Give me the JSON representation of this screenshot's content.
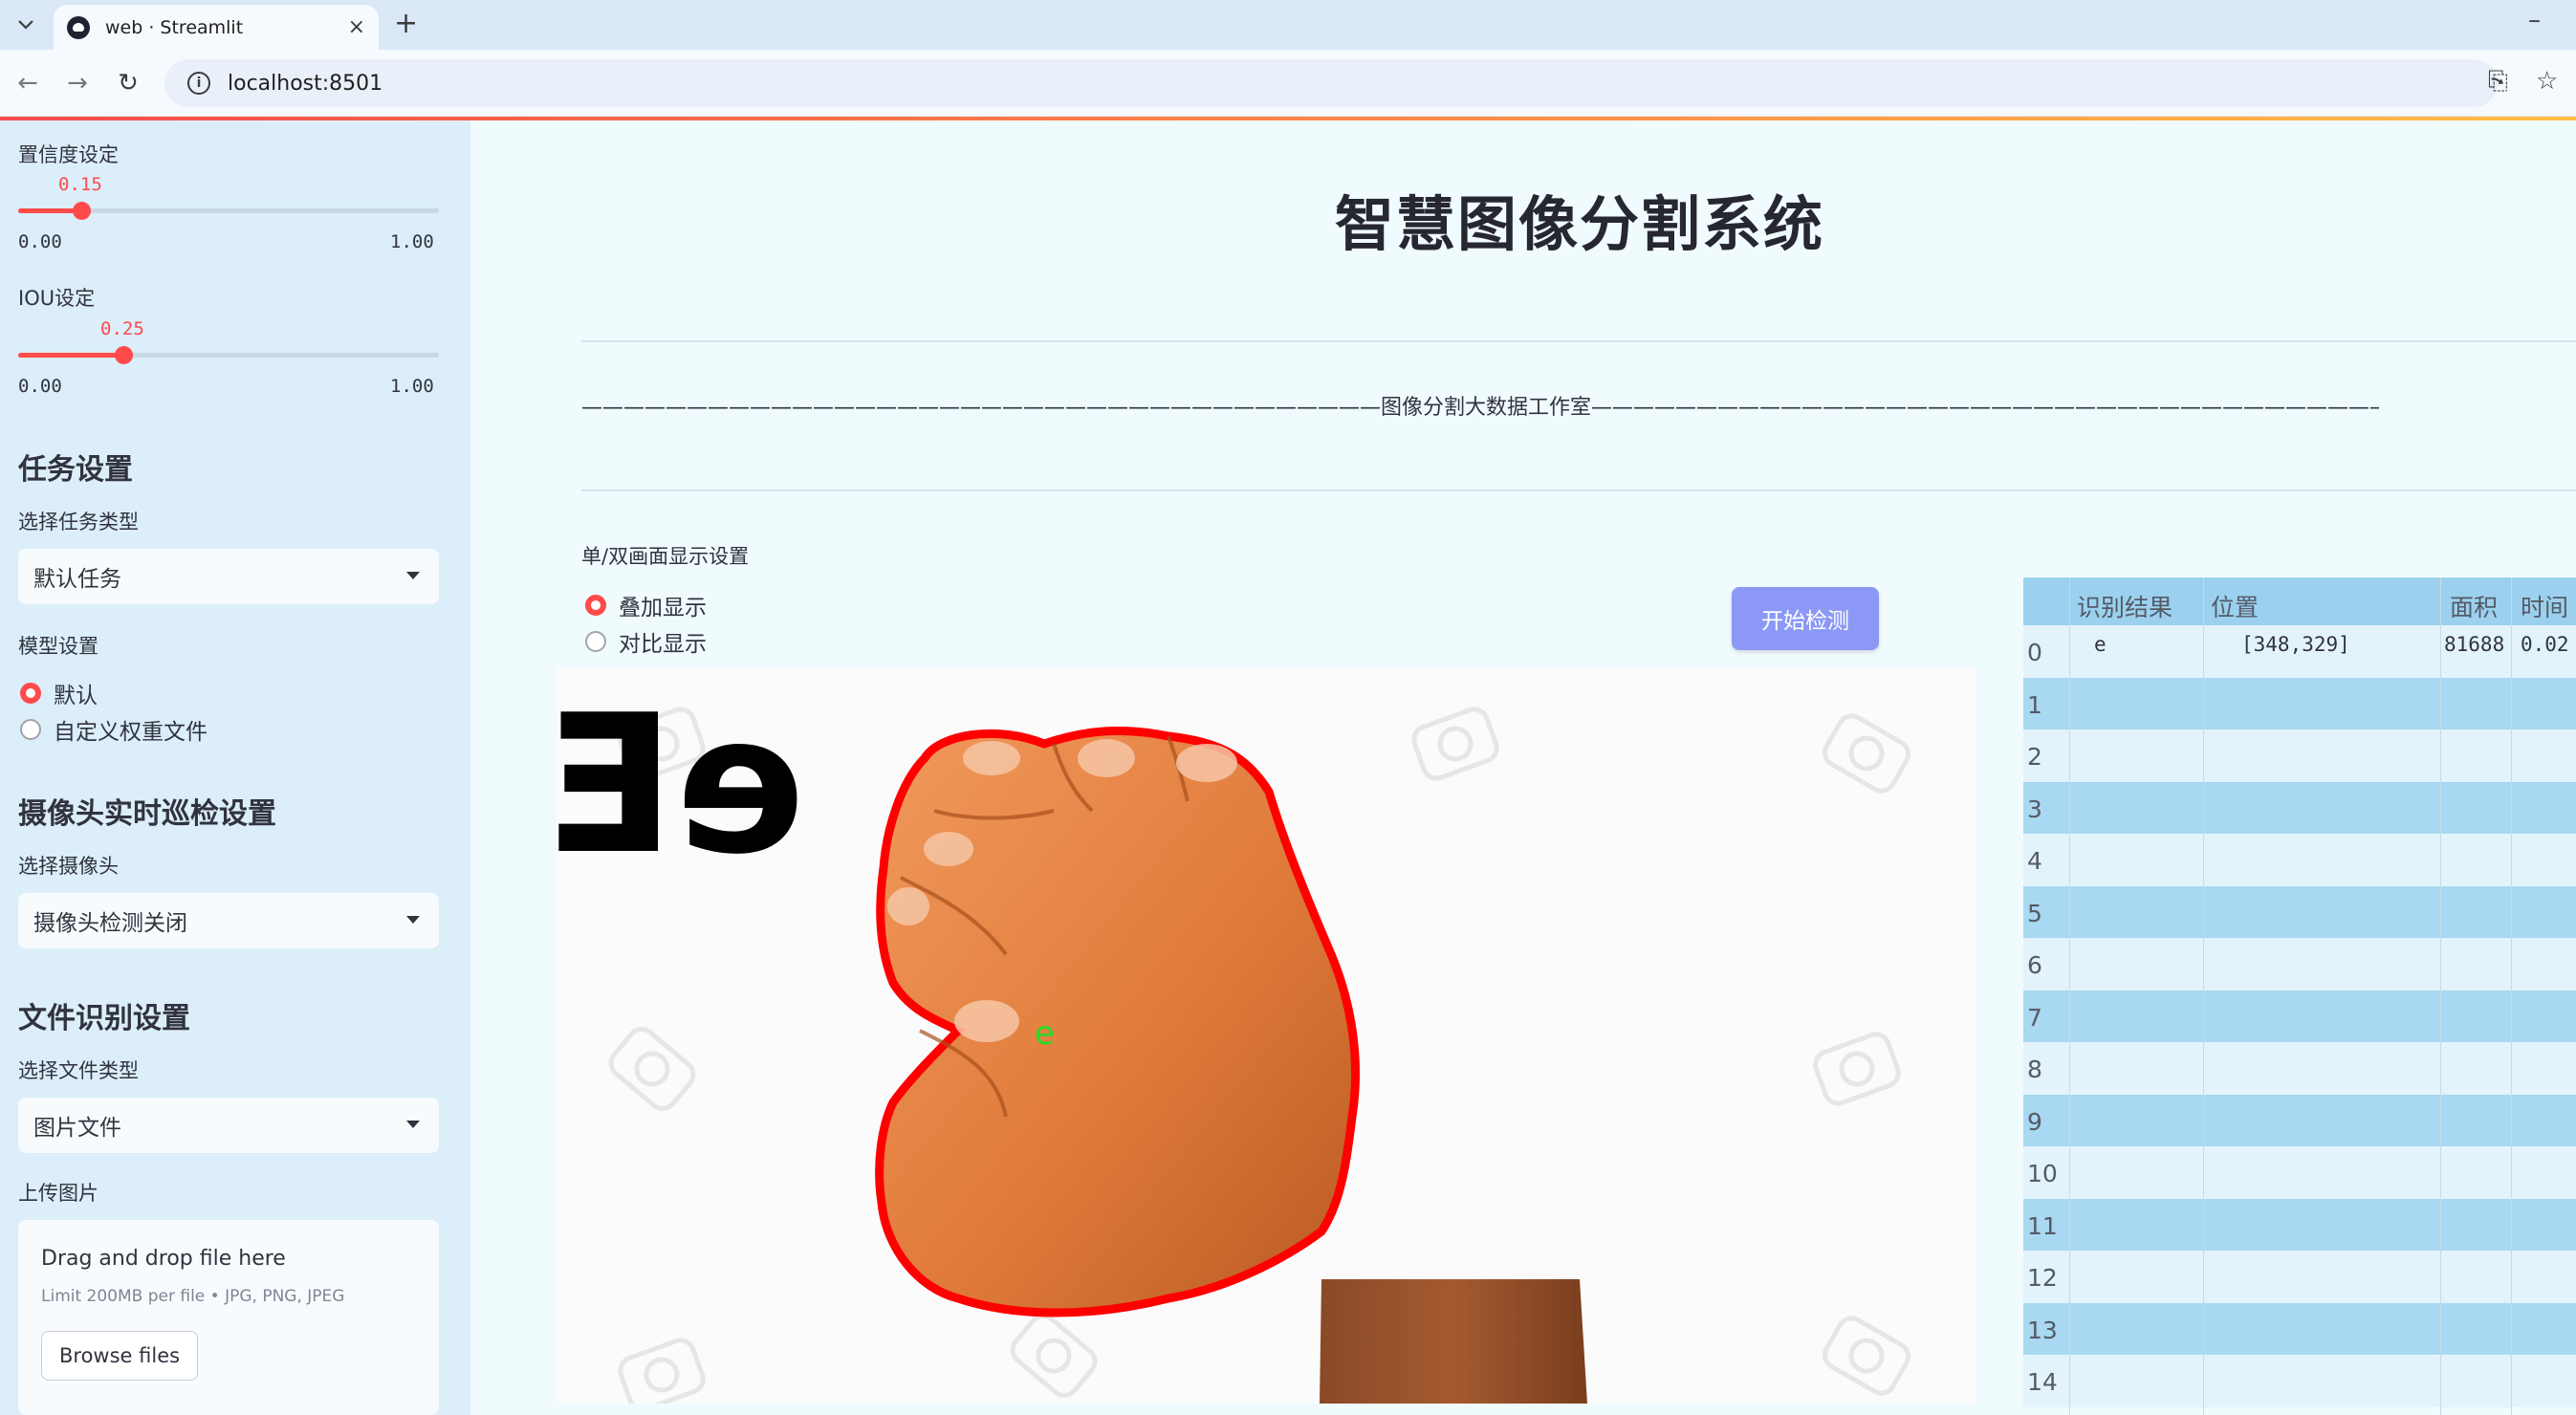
{
  "browser": {
    "tab_title": "web · Streamlit",
    "tab_close": "×",
    "new_tab": "+",
    "minimize": "–",
    "url": "localhost:8501",
    "back": "←",
    "forward": "→",
    "reload": "↻",
    "info": "i",
    "translate": "⎘",
    "star": "☆"
  },
  "sidebar": {
    "confidence": {
      "label": "置信度设定",
      "value_text": "0.15",
      "value": 0.15,
      "min": "0.00",
      "max": "1.00"
    },
    "iou": {
      "label": "IOU设定",
      "value_text": "0.25",
      "value": 0.25,
      "min": "0.00",
      "max": "1.00"
    },
    "task": {
      "header": "任务设置",
      "label": "选择任务类型",
      "selected": "默认任务"
    },
    "model": {
      "label": "模型设置",
      "options": [
        "默认",
        "自定义权重文件"
      ],
      "selected_index": 0
    },
    "camera": {
      "header": "摄像头实时巡检设置",
      "label": "选择摄像头",
      "selected": "摄像头检测关闭"
    },
    "file": {
      "header": "文件识别设置",
      "label": "选择文件类型",
      "selected": "图片文件"
    },
    "upload": {
      "label": "上传图片",
      "drop_text": "Drag and drop file here",
      "limit_text": "Limit 200MB per file • JPG, PNG, JPEG",
      "button": "Browse files"
    }
  },
  "main": {
    "title": "智慧图像分割系统",
    "divider_text": "——————————————————————————————————————图像分割大数据工作室——————————————————————————————————————————————",
    "display_label": "单/双画面显示设置",
    "display_options": [
      "叠加显示",
      "对比显示"
    ],
    "display_selected_index": 0,
    "detect_button": "开始检测",
    "image": {
      "overlay_text": "eE",
      "detection_label": "e",
      "watermark": "123RF"
    }
  },
  "table": {
    "columns": [
      "识别结果",
      "位置",
      "面积",
      "时间"
    ],
    "rows": [
      {
        "index": "0",
        "result": "e",
        "position": "[348,329]",
        "area": "81688",
        "time": "0.02"
      },
      {
        "index": "1",
        "result": "",
        "position": "",
        "area": "",
        "time": ""
      },
      {
        "index": "2",
        "result": "",
        "position": "",
        "area": "",
        "time": ""
      },
      {
        "index": "3",
        "result": "",
        "position": "",
        "area": "",
        "time": ""
      },
      {
        "index": "4",
        "result": "",
        "position": "",
        "area": "",
        "time": ""
      },
      {
        "index": "5",
        "result": "",
        "position": "",
        "area": "",
        "time": ""
      },
      {
        "index": "6",
        "result": "",
        "position": "",
        "area": "",
        "time": ""
      },
      {
        "index": "7",
        "result": "",
        "position": "",
        "area": "",
        "time": ""
      },
      {
        "index": "8",
        "result": "",
        "position": "",
        "area": "",
        "time": ""
      },
      {
        "index": "9",
        "result": "",
        "position": "",
        "area": "",
        "time": ""
      },
      {
        "index": "10",
        "result": "",
        "position": "",
        "area": "",
        "time": ""
      },
      {
        "index": "11",
        "result": "",
        "position": "",
        "area": "",
        "time": ""
      },
      {
        "index": "12",
        "result": "",
        "position": "",
        "area": "",
        "time": ""
      },
      {
        "index": "13",
        "result": "",
        "position": "",
        "area": "",
        "time": ""
      },
      {
        "index": "14",
        "result": "",
        "position": "",
        "area": "",
        "time": ""
      }
    ]
  },
  "colors": {
    "accent": "#ff4b4b",
    "sidebar_bg": "#dbeef9",
    "main_bg": "#f0fbfe",
    "button": "#8c98f5",
    "table_header": "#9bd1ef",
    "table_stripe": "#a9d8f2",
    "table_row": "#e3f3fb",
    "mask_outline": "#ff0000",
    "label_green": "#22dd22"
  }
}
